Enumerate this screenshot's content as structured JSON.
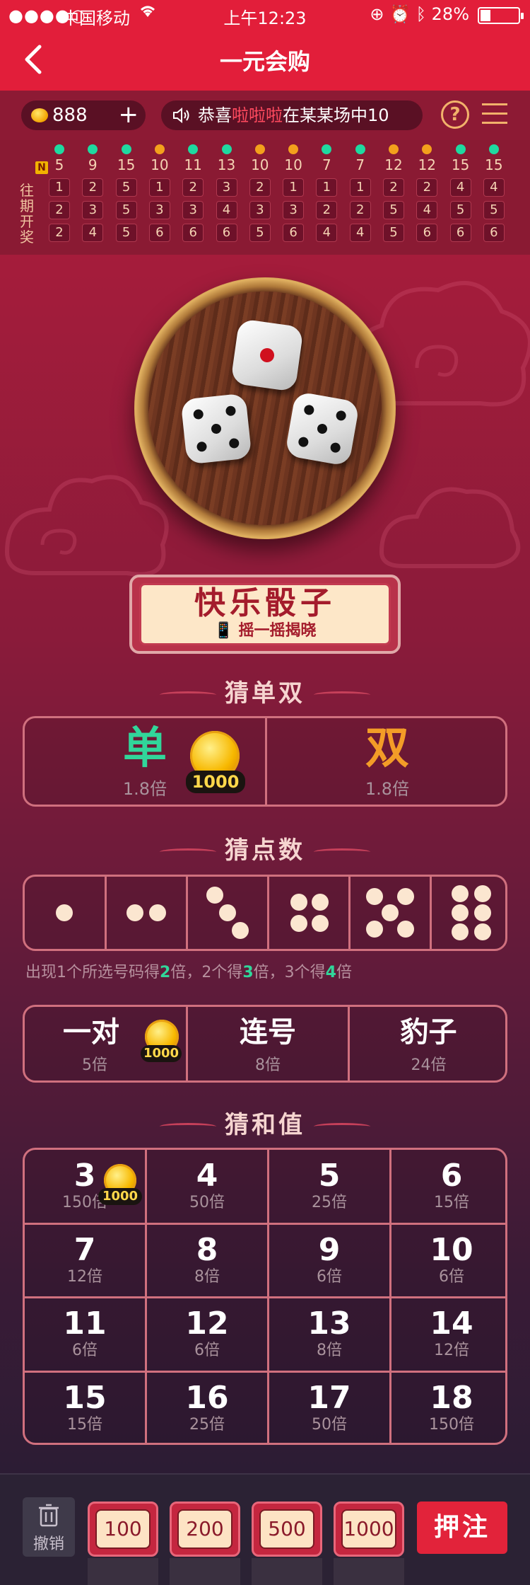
{
  "status": {
    "signal": "●●●●○",
    "carrier": "中国移动",
    "time": "上午12:23",
    "battery": "28%"
  },
  "nav": {
    "title": "一元会购"
  },
  "info": {
    "coins": "888",
    "ticker_prefix": "恭喜",
    "ticker_name": "啦啦啦",
    "ticker_suffix": "在某某场中10",
    "help": "?"
  },
  "history": {
    "label": "往期开奖",
    "badge": "N",
    "columns": [
      {
        "sum": "5",
        "dice": [
          "1",
          "2",
          "2"
        ],
        "dot": "green"
      },
      {
        "sum": "9",
        "dice": [
          "2",
          "3",
          "4"
        ],
        "dot": "green"
      },
      {
        "sum": "15",
        "dice": [
          "5",
          "5",
          "5"
        ],
        "dot": "green"
      },
      {
        "sum": "10",
        "dice": [
          "1",
          "3",
          "6"
        ],
        "dot": "orange"
      },
      {
        "sum": "11",
        "dice": [
          "2",
          "3",
          "6"
        ],
        "dot": "green"
      },
      {
        "sum": "13",
        "dice": [
          "3",
          "4",
          "6"
        ],
        "dot": "green"
      },
      {
        "sum": "10",
        "dice": [
          "2",
          "3",
          "5"
        ],
        "dot": "orange"
      },
      {
        "sum": "10",
        "dice": [
          "1",
          "3",
          "6"
        ],
        "dot": "orange"
      },
      {
        "sum": "7",
        "dice": [
          "1",
          "2",
          "4"
        ],
        "dot": "green"
      },
      {
        "sum": "7",
        "dice": [
          "1",
          "2",
          "4"
        ],
        "dot": "green"
      },
      {
        "sum": "12",
        "dice": [
          "2",
          "5",
          "5"
        ],
        "dot": "orange"
      },
      {
        "sum": "12",
        "dice": [
          "2",
          "4",
          "6"
        ],
        "dot": "orange"
      },
      {
        "sum": "15",
        "dice": [
          "4",
          "5",
          "6"
        ],
        "dot": "green"
      },
      {
        "sum": "15",
        "dice": [
          "4",
          "5",
          "6"
        ],
        "dot": "green"
      }
    ],
    "colors": {
      "green": "#1fd9a0",
      "orange": "#f3a01c"
    }
  },
  "banner": {
    "title": "快乐骰子",
    "subtitle": "摇一摇揭晓"
  },
  "odd_even": {
    "title": "猜单双",
    "odd": {
      "label": "单",
      "mult": "1.8倍",
      "color": "#31d69a"
    },
    "even": {
      "label": "双",
      "mult": "1.8倍",
      "color": "#f39c27"
    },
    "chip": "1000"
  },
  "points": {
    "title": "猜点数",
    "faces": [
      1,
      2,
      3,
      4,
      5,
      6
    ],
    "note_a": "出现1个所选号码得",
    "n1": "2",
    "note_b": "倍，2个得",
    "n2": "3",
    "note_c": "倍，3个得",
    "n3": "4",
    "note_d": "倍"
  },
  "combos": [
    {
      "label": "一对",
      "mult": "5倍",
      "chip": "1000"
    },
    {
      "label": "连号",
      "mult": "8倍"
    },
    {
      "label": "豹子",
      "mult": "24倍"
    }
  ],
  "sums": {
    "title": "猜和值",
    "cells": [
      {
        "n": "3",
        "m": "150倍",
        "chip": "1000"
      },
      {
        "n": "4",
        "m": "50倍"
      },
      {
        "n": "5",
        "m": "25倍"
      },
      {
        "n": "6",
        "m": "15倍"
      },
      {
        "n": "7",
        "m": "12倍"
      },
      {
        "n": "8",
        "m": "8倍"
      },
      {
        "n": "9",
        "m": "6倍"
      },
      {
        "n": "10",
        "m": "6倍"
      },
      {
        "n": "11",
        "m": "6倍"
      },
      {
        "n": "12",
        "m": "6倍"
      },
      {
        "n": "13",
        "m": "8倍"
      },
      {
        "n": "14",
        "m": "12倍"
      },
      {
        "n": "15",
        "m": "15倍"
      },
      {
        "n": "16",
        "m": "25倍"
      },
      {
        "n": "17",
        "m": "50倍"
      },
      {
        "n": "18",
        "m": "150倍"
      }
    ]
  },
  "bottom": {
    "undo": "撤销",
    "chips": [
      "100",
      "200",
      "500",
      "1000"
    ],
    "bet": "押注"
  }
}
